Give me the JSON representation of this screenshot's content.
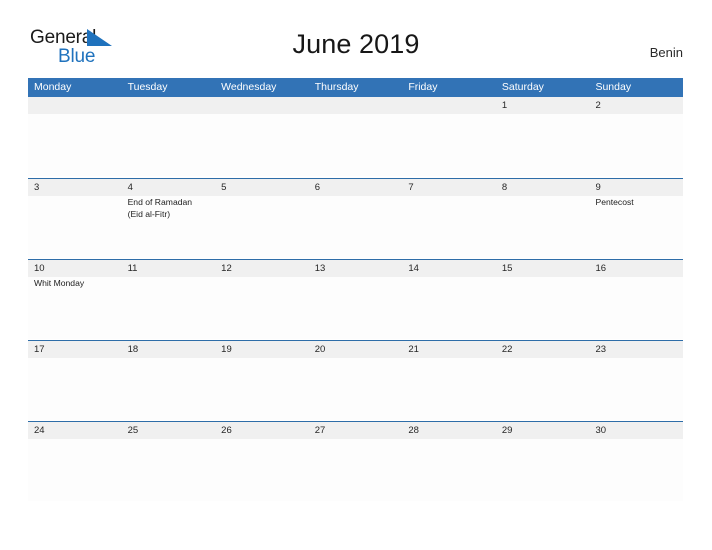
{
  "brand": {
    "name_line1": "General",
    "name_line2": "Blue",
    "mark": "triangle-flag-icon",
    "color_dark": "#1b1b1b",
    "color_blue": "#1f72bd"
  },
  "header": {
    "title": "June 2019",
    "country": "Benin"
  },
  "theme": {
    "header_blue": "#3273b6",
    "rule_blue": "#2e6da8",
    "date_band": "#f0f0f0",
    "cell_bg": "#fdfdfd"
  },
  "weekdays": [
    "Monday",
    "Tuesday",
    "Wednesday",
    "Thursday",
    "Friday",
    "Saturday",
    "Sunday"
  ],
  "weeks": [
    {
      "days": [
        {
          "date": "",
          "events": []
        },
        {
          "date": "",
          "events": []
        },
        {
          "date": "",
          "events": []
        },
        {
          "date": "",
          "events": []
        },
        {
          "date": "",
          "events": []
        },
        {
          "date": "1",
          "events": []
        },
        {
          "date": "2",
          "events": []
        }
      ]
    },
    {
      "days": [
        {
          "date": "3",
          "events": []
        },
        {
          "date": "4",
          "events": [
            "End of Ramadan",
            "(Eid al-Fitr)"
          ]
        },
        {
          "date": "5",
          "events": []
        },
        {
          "date": "6",
          "events": []
        },
        {
          "date": "7",
          "events": []
        },
        {
          "date": "8",
          "events": []
        },
        {
          "date": "9",
          "events": [
            "Pentecost"
          ]
        }
      ]
    },
    {
      "days": [
        {
          "date": "10",
          "events": [
            "Whit Monday"
          ]
        },
        {
          "date": "11",
          "events": []
        },
        {
          "date": "12",
          "events": []
        },
        {
          "date": "13",
          "events": []
        },
        {
          "date": "14",
          "events": []
        },
        {
          "date": "15",
          "events": []
        },
        {
          "date": "16",
          "events": []
        }
      ]
    },
    {
      "days": [
        {
          "date": "17",
          "events": []
        },
        {
          "date": "18",
          "events": []
        },
        {
          "date": "19",
          "events": []
        },
        {
          "date": "20",
          "events": []
        },
        {
          "date": "21",
          "events": []
        },
        {
          "date": "22",
          "events": []
        },
        {
          "date": "23",
          "events": []
        }
      ]
    },
    {
      "days": [
        {
          "date": "24",
          "events": []
        },
        {
          "date": "25",
          "events": []
        },
        {
          "date": "26",
          "events": []
        },
        {
          "date": "27",
          "events": []
        },
        {
          "date": "28",
          "events": []
        },
        {
          "date": "29",
          "events": []
        },
        {
          "date": "30",
          "events": []
        }
      ]
    }
  ]
}
